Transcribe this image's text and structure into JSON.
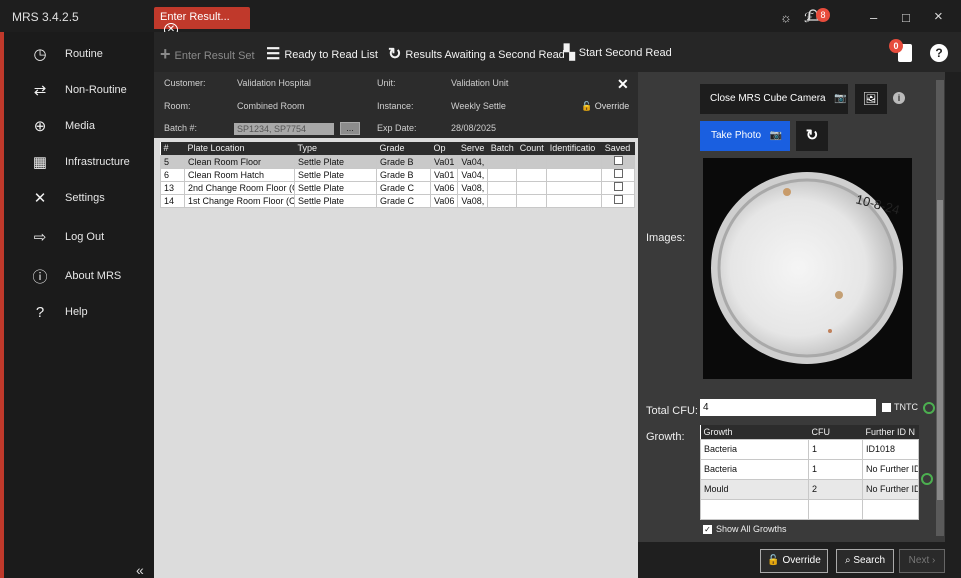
{
  "app": {
    "title": "MRS 3.4.2.5"
  },
  "tab": {
    "label": "Enter Result...",
    "close": "✕"
  },
  "window_icons": {
    "settings": "☼",
    "signal": "ℱ",
    "bell": "🔔",
    "notif_count": "8",
    "minimize": "–",
    "maximize": "□",
    "close": "×"
  },
  "sidebar": {
    "items": [
      {
        "label": "Routine",
        "icon": "clock-icon",
        "glyph": "◷"
      },
      {
        "label": "Non-Routine",
        "icon": "shuffle-icon",
        "glyph": "⇄"
      },
      {
        "label": "Media",
        "icon": "media-icon",
        "glyph": "⊕"
      },
      {
        "label": "Infrastructure",
        "icon": "infrastructure-icon",
        "glyph": "▦"
      },
      {
        "label": "Settings",
        "icon": "tools-icon",
        "glyph": "✕"
      },
      {
        "label": "Log Out",
        "icon": "logout-icon",
        "glyph": "⇨"
      },
      {
        "label": "About MRS",
        "icon": "info-icon",
        "glyph": "ⓘ"
      },
      {
        "label": "Help",
        "icon": "help-icon",
        "glyph": "?"
      }
    ],
    "collapse": "«"
  },
  "toolbar": {
    "enter_result_set": "Enter Result Set",
    "ready_to_read": "Ready to Read List",
    "awaiting_second": "Results Awaiting a Second Read",
    "start_second": "Start Second Read",
    "doc_badge": "0",
    "help": "?"
  },
  "info": {
    "customer_lbl": "Customer:",
    "customer": "Validation Hospital",
    "unit_lbl": "Unit:",
    "unit": "Validation Unit",
    "room_lbl": "Room:",
    "room": "Combined Room",
    "instance_lbl": "Instance:",
    "instance": "Weekly Settle",
    "batch_lbl": "Batch #:",
    "batch": "SP1234, SP7754",
    "batch_btn": "...",
    "exp_lbl": "Exp Date:",
    "exp": "28/08/2025",
    "override": "Override"
  },
  "plates": {
    "headers": [
      "#",
      "Plate Location",
      "Type",
      "Grade",
      "Op",
      "Serve",
      "Batch",
      "Count",
      "Identificatio",
      "Saved"
    ],
    "rows": [
      [
        "5",
        "Clean Room Floor",
        "Settle Plate",
        "Grade B",
        "Va01",
        "Va04,",
        "",
        "",
        "",
        ""
      ],
      [
        "6",
        "Clean Room Hatch",
        "Settle Plate",
        "Grade B",
        "Va01",
        "Va04,",
        "",
        "",
        "",
        ""
      ],
      [
        "13",
        "2nd Change Room Floor (C",
        "Settle Plate",
        "Grade C",
        "Va06",
        "Va08,",
        "",
        "",
        "",
        ""
      ],
      [
        "14",
        "1st Change Room Floor (Cl",
        "Settle Plate",
        "Grade C",
        "Va06",
        "Va08,",
        "",
        "",
        "",
        ""
      ]
    ]
  },
  "right": {
    "close_camera": "Close MRS Cube Camera",
    "take_photo": "Take Photo",
    "images_lbl": "Images:",
    "total_cfu_lbl": "Total CFU:",
    "total_cfu": "4",
    "tntc": "TNTC",
    "growth_lbl": "Growth:",
    "growth_headers": [
      "Growth",
      "CFU",
      "Further ID N"
    ],
    "growth_rows": [
      [
        "Bacteria",
        "1",
        "ID1018"
      ],
      [
        "Bacteria",
        "1",
        "No Further ID"
      ],
      [
        "Mould",
        "2",
        "No Further ID"
      ],
      [
        "",
        "",
        ""
      ]
    ],
    "show_all": "Show All Growths",
    "plate_writing": "10-8-24"
  },
  "bottom": {
    "override": "Override",
    "search": "Search",
    "next": "Next"
  }
}
